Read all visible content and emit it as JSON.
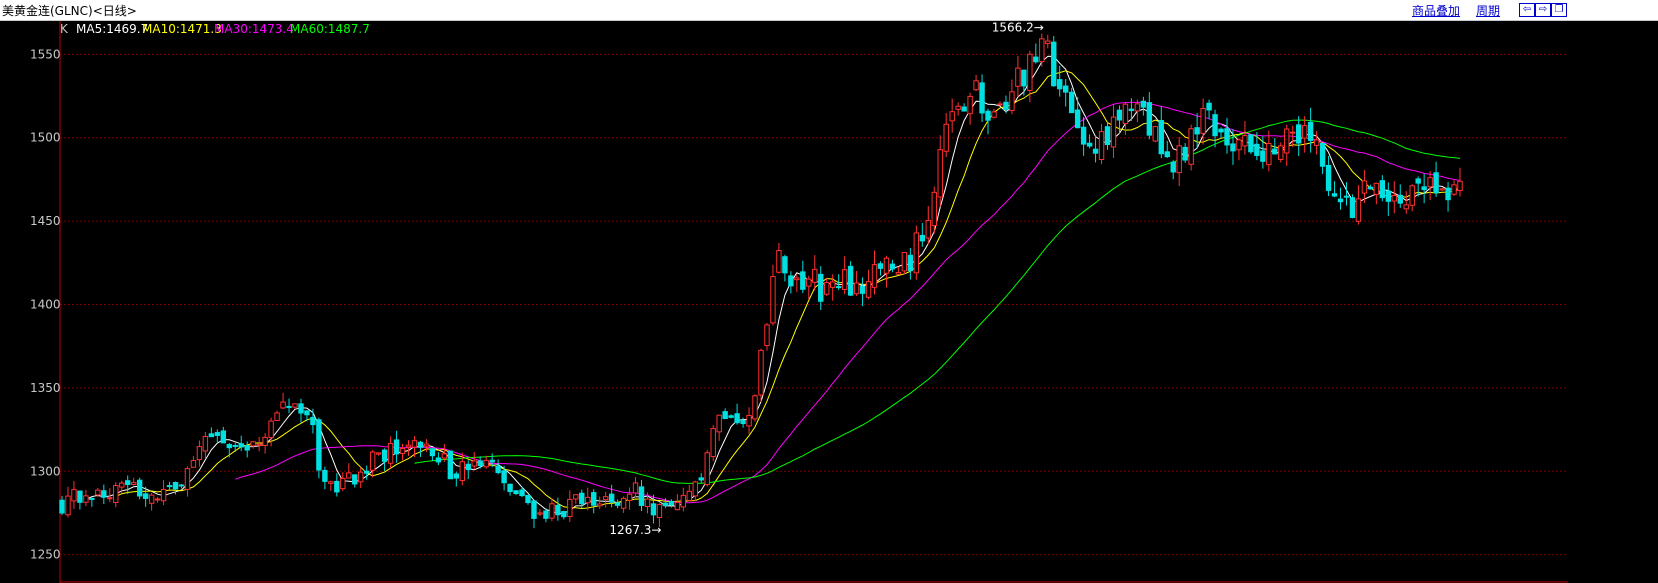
{
  "window": {
    "title": "美黄金连(GLNC)<日线>",
    "overlay_link": "商品叠加",
    "period_link": "周期",
    "nav_buttons": [
      {
        "name": "nav-prev-icon",
        "glyph": "⇦"
      },
      {
        "name": "nav-next-icon",
        "glyph": "⇨"
      },
      {
        "name": "window-restore-icon",
        "glyph": "❐"
      }
    ]
  },
  "colors": {
    "background": "#000000",
    "grid": "#7a0000",
    "up": "#ff3030",
    "down": "#00e0e0",
    "axis_text": "#c8c8c8",
    "ma5": "#ffffff",
    "ma10": "#ffff00",
    "ma30": "#ff00ff",
    "ma60": "#00ff00"
  },
  "chart_data": {
    "type": "candlestick",
    "indicator_prefix": "K",
    "indicators": [
      {
        "name": "MA5",
        "text": "MA5:1469.7",
        "value": 1469.7,
        "color": "#ffffff"
      },
      {
        "name": "MA10",
        "text": "MA10:1471.3",
        "value": 1471.3,
        "color": "#ffff00"
      },
      {
        "name": "MA30",
        "text": "MA30:1473.4",
        "value": 1473.4,
        "color": "#ff00ff"
      },
      {
        "name": "MA60",
        "text": "MA60:1487.7",
        "value": 1487.7,
        "color": "#00ff00"
      }
    ],
    "yticks": [
      1250,
      1300,
      1350,
      1400,
      1450,
      1500,
      1550
    ],
    "ylim": [
      1233,
      1570
    ],
    "grid": true,
    "annotations": [
      {
        "text": "1566.2→",
        "value": 1566.2
      },
      {
        "text": "1267.3→",
        "value": 1267.3
      }
    ],
    "bars": 235,
    "price_path": [
      [
        0,
        1281
      ],
      [
        5,
        1285
      ],
      [
        12,
        1290
      ],
      [
        18,
        1291
      ],
      [
        22,
        1284
      ],
      [
        28,
        1287
      ],
      [
        32,
        1310
      ],
      [
        36,
        1320
      ],
      [
        40,
        1318
      ],
      [
        45,
        1315
      ],
      [
        50,
        1322
      ],
      [
        56,
        1340
      ],
      [
        60,
        1335
      ],
      [
        62,
        1328
      ],
      [
        65,
        1292
      ],
      [
        70,
        1290
      ],
      [
        76,
        1305
      ],
      [
        82,
        1312
      ],
      [
        88,
        1320
      ],
      [
        93,
        1310
      ],
      [
        98,
        1298
      ],
      [
        104,
        1305
      ],
      [
        108,
        1298
      ],
      [
        112,
        1285
      ],
      [
        118,
        1275
      ],
      [
        124,
        1278
      ],
      [
        130,
        1282
      ],
      [
        134,
        1280
      ],
      [
        138,
        1285
      ],
      [
        142,
        1290
      ],
      [
        146,
        1280
      ],
      [
        150,
        1275
      ],
      [
        153,
        1278
      ],
      [
        156,
        1282
      ],
      [
        160,
        1300
      ],
      [
        163,
        1330
      ],
      [
        166,
        1340
      ],
      [
        169,
        1330
      ],
      [
        172,
        1340
      ],
      [
        175,
        1380
      ],
      [
        178,
        1425
      ],
      [
        181,
        1420
      ],
      [
        184,
        1405
      ],
      [
        187,
        1415
      ],
      [
        191,
        1405
      ],
      [
        195,
        1413
      ],
      [
        199,
        1410
      ],
      [
        203,
        1425
      ],
      [
        207,
        1420
      ],
      [
        211,
        1425
      ],
      [
        214,
        1445
      ],
      [
        217,
        1470
      ],
      [
        220,
        1505
      ],
      [
        224,
        1515
      ],
      [
        228,
        1530
      ],
      [
        231,
        1505
      ],
      [
        234,
        1515
      ],
      [
        238,
        1535
      ],
      [
        242,
        1545
      ],
      [
        245,
        1555
      ],
      [
        248,
        1530
      ],
      [
        252,
        1505
      ],
      [
        256,
        1495
      ],
      [
        260,
        1503
      ],
      [
        264,
        1510
      ],
      [
        268,
        1530
      ],
      [
        272,
        1500
      ],
      [
        276,
        1478
      ],
      [
        280,
        1495
      ],
      [
        284,
        1515
      ],
      [
        288,
        1505
      ],
      [
        292,
        1497
      ],
      [
        296,
        1490
      ],
      [
        300,
        1495
      ],
      [
        304,
        1500
      ],
      [
        308,
        1505
      ],
      [
        312,
        1495
      ],
      [
        316,
        1470
      ],
      [
        320,
        1455
      ],
      [
        324,
        1465
      ],
      [
        328,
        1470
      ],
      [
        332,
        1462
      ],
      [
        336,
        1468
      ],
      [
        340,
        1478
      ],
      [
        344,
        1472
      ],
      [
        348,
        1468
      ]
    ],
    "seed": 20240611
  }
}
